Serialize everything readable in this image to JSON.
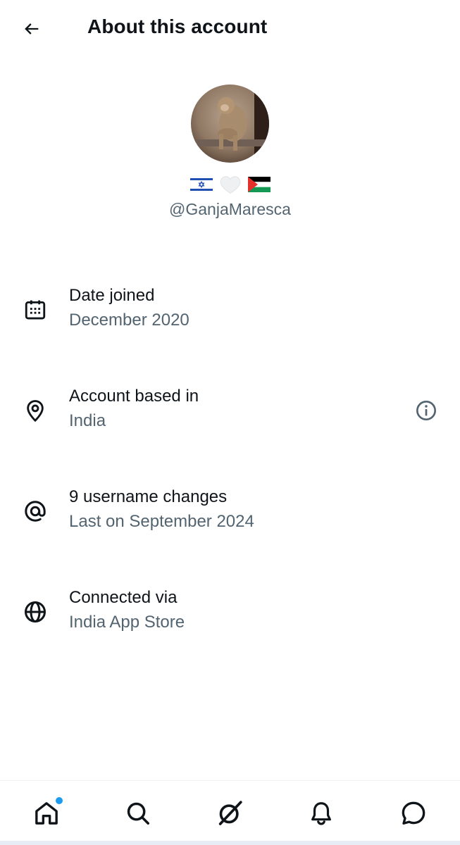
{
  "header": {
    "title": "About this account",
    "back_icon": "arrow-left-icon"
  },
  "profile": {
    "handle": "@GanjaMaresca",
    "bio_emojis": [
      "israel-flag",
      "white-heart",
      "palestine-flag"
    ]
  },
  "details": [
    {
      "icon": "calendar-icon",
      "label": "Date joined",
      "value": "December 2020"
    },
    {
      "icon": "location-pin-icon",
      "label": "Account based in",
      "value": "India",
      "info_icon": "info-icon"
    },
    {
      "icon": "at-sign-icon",
      "label": "9 username changes",
      "value": "Last on September 2024"
    },
    {
      "icon": "globe-icon",
      "label": "Connected via",
      "value": "India App Store"
    }
  ],
  "bottom_nav": {
    "items": [
      "home-icon",
      "search-icon",
      "grok-icon",
      "notifications-icon",
      "messages-icon"
    ],
    "home_has_unread": true
  },
  "colors": {
    "text_primary": "#0f1419",
    "text_secondary": "#536471",
    "accent": "#1d9bf0"
  }
}
